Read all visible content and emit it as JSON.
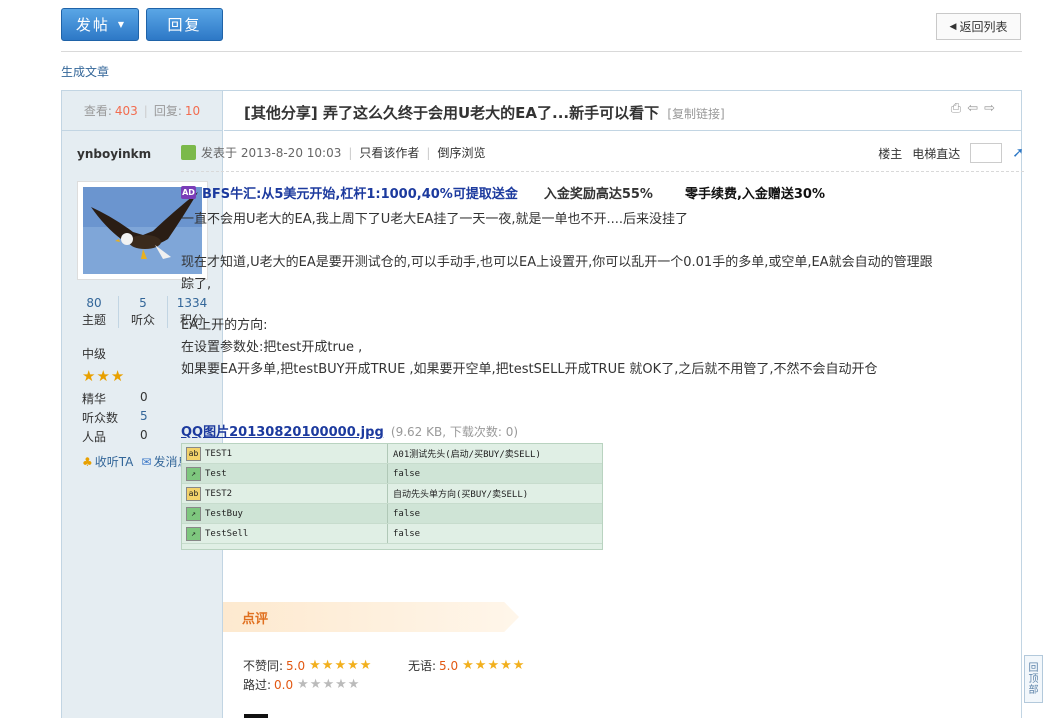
{
  "toolbar": {
    "post_label": "发帖",
    "reply_label": "回复",
    "back_label": "返回列表"
  },
  "breadcrumb": "生成文章",
  "stats": {
    "views_label": "查看:",
    "views": "403",
    "replies_label": "回复:",
    "replies": "10"
  },
  "thread": {
    "category": "[其他分享]",
    "title": "弄了这么久终于会用U老大的EA了...新手可以看下",
    "copy_link": "[复制链接]"
  },
  "author": {
    "name": "ynboyinkm",
    "counts": [
      {
        "num": "80",
        "label": "主题"
      },
      {
        "num": "5",
        "label": "听众"
      },
      {
        "num": "1334",
        "label": "积分"
      }
    ],
    "rank": "中级",
    "rank_stars": "★★★",
    "info": [
      {
        "label": "精华",
        "value": "0"
      },
      {
        "label": "听众数",
        "value": "5"
      },
      {
        "label": "人品",
        "value": "0"
      }
    ],
    "actions": {
      "follow": "收听TA",
      "message": "发消息"
    }
  },
  "post_meta": {
    "posted_prefix": "发表于",
    "posted_at": "2013-8-20 10:03",
    "only_author": "只看该作者",
    "reverse": "倒序浏览",
    "floor": "楼主",
    "jump_label": "电梯直达"
  },
  "promo": {
    "link": "BFS牛汇:从5美元开始,杠杆1:1000,40%可提取送金",
    "t2": "入金奖励高达55%",
    "t3": "零手续费,入金赠送30%"
  },
  "body": {
    "p1": "一直不会用U老大的EA,我上周下了U老大EA挂了一天一夜,就是一单也不开....后来没挂了",
    "p2": "现在才知道,U老大的EA是要开测试仓的,可以手动手,也可以EA上设置开,你可以乱开一个0.01手的多单,或空单,EA就会自动的管理跟踪了,",
    "p3_l1": "EA上开的方向:",
    "p3_l2": "在设置参数处:把test开成true ,",
    "p3_l3": "如果要EA开多单,把testBUY开成TRUE ,如果要开空单,把testSELL开成TRUE 就OK了,之后就不用管了,不然不会自动开仓"
  },
  "attachment": {
    "name": "QQ图片20130820100000.jpg",
    "meta": "(9.62 KB, 下载次数: 0)",
    "rows": [
      {
        "icon": "ab",
        "name": "TEST1",
        "value": "A01测试先头(启动/买BUY/卖SELL)"
      },
      {
        "icon": "ln",
        "name": "Test",
        "value": "false"
      },
      {
        "icon": "ab",
        "name": "TEST2",
        "value": "自动先头单方向(买BUY/卖SELL)"
      },
      {
        "icon": "ln",
        "name": "TestBuy",
        "value": "false"
      },
      {
        "icon": "ln",
        "name": "TestSell",
        "value": "false"
      }
    ]
  },
  "review": {
    "title": "点评",
    "ratings": [
      {
        "label": "不赞同:",
        "score": "5.0",
        "stars": "★★★★★"
      },
      {
        "label": "无语:",
        "score": "5.0",
        "stars": "★★★★★"
      },
      {
        "label": "路过:",
        "score": "0.0",
        "stars": "★★★★★"
      }
    ]
  },
  "back_to_top": [
    "回",
    "顶",
    "部"
  ],
  "colors": {
    "accent": "#2d78c6",
    "score": "#e25812",
    "link": "#1c3a9e",
    "border": "#c2d5e3"
  }
}
